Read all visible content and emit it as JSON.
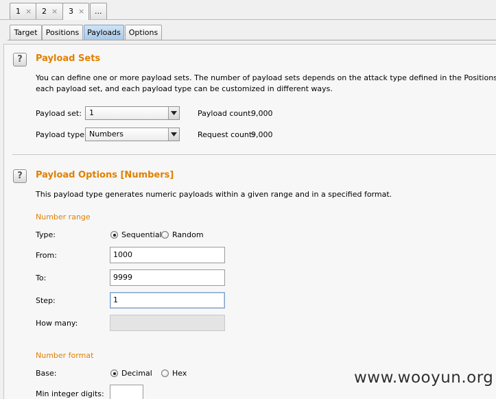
{
  "attack_tabs": [
    {
      "label": "1",
      "close": "×"
    },
    {
      "label": "2",
      "close": "×"
    },
    {
      "label": "3",
      "close": "×"
    },
    {
      "label": "..."
    }
  ],
  "sub_tabs": [
    {
      "label": "Target"
    },
    {
      "label": "Positions"
    },
    {
      "label": "Payloads"
    },
    {
      "label": "Options"
    }
  ],
  "help_glyph": "?",
  "payload_sets": {
    "title": "Payload Sets",
    "desc_line1": "You can define one or more payload sets. The number of payload sets depends on the attack type defined in the Positions tab. Various payload types are available for",
    "desc_line2": "each payload set, and each payload type can be customized in different ways.",
    "set_label": "Payload set:",
    "set_value": "1",
    "type_label": "Payload type:",
    "type_value": "Numbers",
    "payload_count_label": "Payload count:",
    "payload_count_value": "9,000",
    "request_count_label": "Request count:",
    "request_count_value": "9,000"
  },
  "payload_options": {
    "title": "Payload Options [Numbers]",
    "desc": "This payload type generates numeric payloads within a given range and in a specified format.",
    "number_range_heading": "Number range",
    "type_label": "Type:",
    "type_options": [
      {
        "label": "Sequential",
        "checked": true
      },
      {
        "label": "Random",
        "checked": false
      }
    ],
    "from_label": "From:",
    "from_value": "1000",
    "to_label": "To:",
    "to_value": "9999",
    "step_label": "Step:",
    "step_value": "1",
    "how_many_label": "How many:",
    "number_format_heading": "Number format",
    "base_label": "Base:",
    "base_options": [
      {
        "label": "Decimal",
        "checked": true
      },
      {
        "label": "Hex",
        "checked": false
      }
    ],
    "min_int_label": "Min integer digits:"
  },
  "watermark": "www.wooyun.org",
  "colors": {
    "heading_orange": "#e08000",
    "active_tab_blue": "#a9c9e8",
    "panel_bg": "#f7f7f7"
  },
  "icons": {
    "combo_arrow": "triangle-down-icon",
    "help": "help-icon",
    "close": "close-icon"
  }
}
